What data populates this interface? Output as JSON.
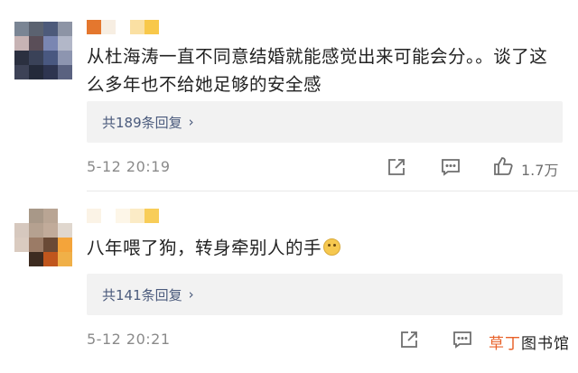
{
  "comments": [
    {
      "text": "从杜海涛一直不同意结婚就能感觉出来可能会分。。谈了这么多年也不给她足够的安全感",
      "replies_label": "共189条回复",
      "time": "5-12 20:19",
      "likes": "1.7万"
    },
    {
      "text": "八年喂了狗，转身牵别人的手",
      "emoji": "smiling-face-emoji",
      "replies_label": "共141条回复",
      "time": "5-12 20:21"
    }
  ],
  "watermark": {
    "highlight": "草丁",
    "rest": "图书馆"
  },
  "colors": {
    "reply_link": "#4a5a7c",
    "meta_gray": "#8a8a8a",
    "reply_bg": "#f2f2f2",
    "watermark_accent": "#e8622a"
  },
  "icons": [
    "forward-icon",
    "comment-icon",
    "like-icon",
    "chevron-right-icon"
  ]
}
